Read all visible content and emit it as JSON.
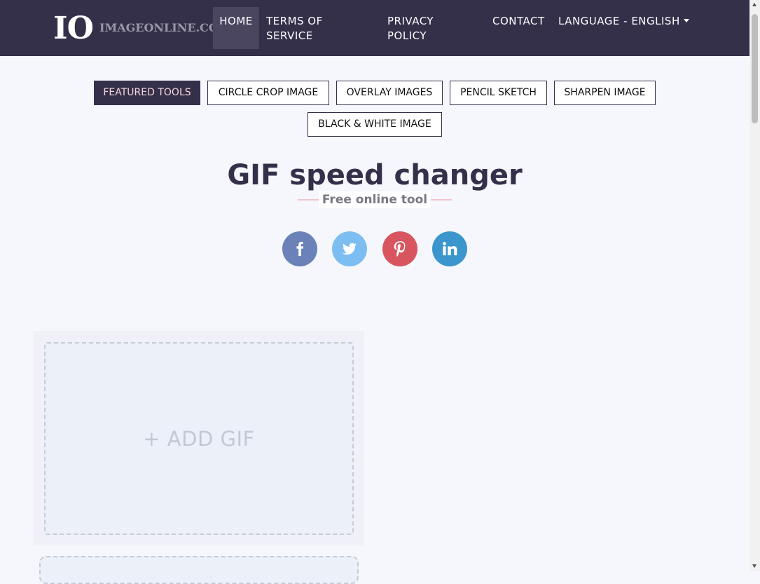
{
  "brand": {
    "mark": "IO",
    "name": "IMAGEONLINE.CO"
  },
  "nav": {
    "home": "HOME",
    "terms": "TERMS OF SERVICE",
    "privacy": "PRIVACY POLICY",
    "contact": "CONTACT",
    "language": "LANGUAGE - ENGLISH"
  },
  "tools": [
    "FEATURED TOOLS",
    "CIRCLE CROP IMAGE",
    "OVERLAY IMAGES",
    "PENCIL SKETCH",
    "SHARPEN IMAGE",
    "BLACK & WHITE IMAGE"
  ],
  "title": "GIF speed changer",
  "subtitle": "Free online tool",
  "social": [
    {
      "icon": "facebook-icon",
      "color": "#6b82b8"
    },
    {
      "icon": "twitter-icon",
      "color": "#7dbef2"
    },
    {
      "icon": "pinterest-icon",
      "color": "#d8545f"
    },
    {
      "icon": "linkedin-icon",
      "color": "#3a96cc"
    }
  ],
  "upload": {
    "label": "+ ADD GIF"
  },
  "colors": {
    "navbar": "#35304a",
    "active_tab": "#4b4660",
    "accent_text": "#f6d4dc",
    "background": "#f6f7fc"
  }
}
